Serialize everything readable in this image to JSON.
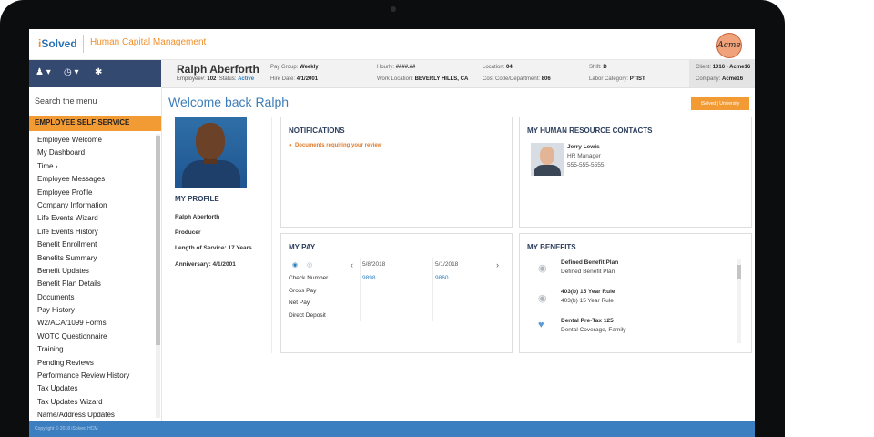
{
  "header": {
    "logo_i": "i",
    "logo_rest": "Solved",
    "app_title": "Human Capital Management",
    "company_logo": "Acme"
  },
  "nav_icons": [
    "user-icon",
    "clock-icon",
    "pin-icon"
  ],
  "employee": {
    "name": "Ralph Aberforth",
    "employee_label": "Employee#:",
    "employee_number": "102",
    "status_label": "Status:",
    "status": "Active",
    "fields": {
      "pay_group_label": "Pay Group:",
      "pay_group": "Weekly",
      "hire_date_label": "Hire Date:",
      "hire_date": "4/1/2001",
      "hourly_label": "Hourly:",
      "hourly": "####.##",
      "work_location_label": "Work Location:",
      "work_location": "BEVERLY HILLS, CA",
      "location_label": "Location:",
      "location": "04",
      "cost_code_label": "Cost Code/Department:",
      "cost_code": "806",
      "shift_label": "Shift:",
      "shift": "D",
      "labor_category_label": "Labor Category:",
      "labor_category": "PTIST",
      "client_label": "Client:",
      "client": "1016 - Acme16",
      "company_label": "Company:",
      "company": "Acme16"
    }
  },
  "sidebar": {
    "search_placeholder": "Search the menu",
    "section_title": "EMPLOYEE SELF SERVICE",
    "items": [
      "Employee Welcome",
      "My Dashboard",
      "Time  ›",
      "Employee Messages",
      "Employee Profile",
      "Company Information",
      "Life Events Wizard",
      "Life Events History",
      "Benefit Enrollment",
      "Benefits Summary",
      "Benefit Updates",
      "Benefit Plan Details",
      "Documents",
      "Pay History",
      "W2/ACA/1099 Forms",
      "WOTC Questionnaire",
      "Training",
      "Pending Reviews",
      "Performance Review History",
      "Tax Updates",
      "Tax Updates Wizard",
      "Name/Address Updates"
    ]
  },
  "main": {
    "welcome": "Welcome back Ralph",
    "university_badge": "iSolved | University",
    "profile": {
      "title": "MY PROFILE",
      "name": "Ralph Aberforth",
      "role": "Producer",
      "service": "Length of Service: 17 Years",
      "anniversary": "Anniversary: 4/1/2001"
    },
    "notifications": {
      "title": "NOTIFICATIONS",
      "item": "Documents requiring your review"
    },
    "hr_contacts": {
      "title": "MY HUMAN RESOURCE CONTACTS",
      "name": "Jerry Lewis",
      "role": "HR Manager",
      "phone": "555-555-5555"
    },
    "pay": {
      "title": "MY PAY",
      "labels": [
        "Check Number",
        "Gross Pay",
        "Net Pay",
        "Direct Deposit"
      ],
      "columns": [
        {
          "date": "5/8/2018",
          "check": "9898"
        },
        {
          "date": "5/1/2018",
          "check": "9860"
        }
      ],
      "prev": "‹",
      "next": "›"
    },
    "benefits": {
      "title": "MY BENEFITS",
      "items": [
        {
          "name": "Defined Benefit Plan",
          "sub": "Defined Benefit Plan",
          "icon": "piggy-bank-icon"
        },
        {
          "name": "403(b) 15 Year Rule",
          "sub": "403(b) 15 Year Rule",
          "icon": "piggy-bank-icon"
        },
        {
          "name": "Dental Pre-Tax 125",
          "sub": "Dental Coverage, Family",
          "icon": "tooth-icon"
        }
      ]
    }
  },
  "footer": {
    "copyright": "Copyright © 2018 iSolved HCM"
  },
  "colors": {
    "brand_orange": "#f29a33",
    "brand_blue": "#3c7fc1",
    "nav_dark": "#33496f"
  }
}
